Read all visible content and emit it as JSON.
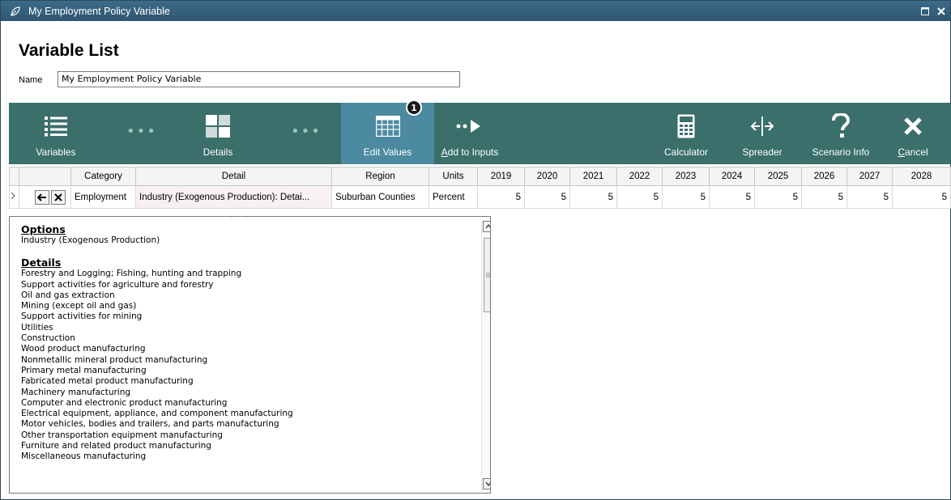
{
  "window": {
    "title": "My Employment Policy Variable"
  },
  "page": {
    "heading": "Variable List",
    "name_label": "Name",
    "name_value": "My Employment Policy Variable"
  },
  "toolbar": {
    "variables": "Variables",
    "details": "Details",
    "edit_values": "Edit Values",
    "edit_values_badge": "1",
    "add_to_inputs_prefix": "A",
    "add_to_inputs_rest": "dd to Inputs",
    "calculator": "Calculator",
    "spreader": "Spreader",
    "scenario_info": "Scenario Info",
    "cancel_prefix": "C",
    "cancel_rest": "ancel"
  },
  "grid": {
    "headers": [
      "Category",
      "Detail",
      "Region",
      "Units",
      "2019",
      "2020",
      "2021",
      "2022",
      "2023",
      "2024",
      "2025",
      "2026",
      "2027",
      "2028"
    ],
    "row": {
      "category": "Employment",
      "detail": "Industry (Exogenous Production): Detai...",
      "region": "Suburban Counties",
      "units": "Percent",
      "values": [
        "5",
        "5",
        "5",
        "5",
        "5",
        "5",
        "5",
        "5",
        "5",
        "5"
      ]
    }
  },
  "dropdown": {
    "options_heading": "Options",
    "options": [
      "Industry (Exogenous Production)"
    ],
    "details_heading": "Details",
    "details": [
      "Forestry and Logging; Fishing, hunting and trapping",
      "Support activities for agriculture and forestry",
      "Oil and gas extraction",
      "Mining (except oil and gas)",
      "Support activities for mining",
      "Utilities",
      "Construction",
      "Wood product manufacturing",
      "Nonmetallic mineral product manufacturing",
      "Primary metal manufacturing",
      "Fabricated metal product manufacturing",
      "Machinery manufacturing",
      "Computer and electronic product manufacturing",
      "Electrical equipment, appliance, and component manufacturing",
      "Motor vehicles, bodies and trailers, and parts manufacturing",
      "Other transportation equipment manufacturing",
      "Furniture and related product manufacturing",
      "Miscellaneous manufacturing"
    ]
  },
  "colors": {
    "titlebar": "#2e5670",
    "toolbar": "#3a6f6b",
    "toolbar_active": "#4b8aa0"
  },
  "icons": [
    "leaf-icon",
    "maximize-icon",
    "close-icon",
    "list-icon",
    "details-icon",
    "grid-icon",
    "arrow-dots-icon",
    "calculator-icon",
    "spreader-icon",
    "question-icon",
    "cancel-icon",
    "back-arrow-icon",
    "delete-icon",
    "scroll-up-icon",
    "scroll-down-icon"
  ]
}
